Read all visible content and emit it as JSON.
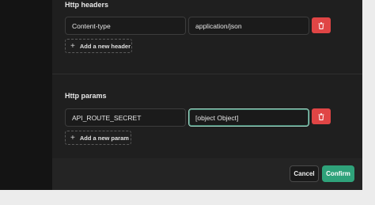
{
  "headers_section": {
    "title": "Http headers",
    "rows": [
      {
        "key": "Content-type",
        "value": "application/json"
      }
    ],
    "add_label": "Add a new header"
  },
  "params_section": {
    "title": "Http params",
    "rows": [
      {
        "key": "API_ROUTE_SECRET",
        "value": "[object Object]"
      }
    ],
    "add_label": "Add a new param"
  },
  "footer": {
    "cancel_label": "Cancel",
    "confirm_label": "Confirm"
  },
  "colors": {
    "delete": "#e04545",
    "confirm": "#2fa27a",
    "active_border": "#9fd8c6"
  },
  "icons": {
    "delete": "trash-icon",
    "add": "plus-icon"
  }
}
